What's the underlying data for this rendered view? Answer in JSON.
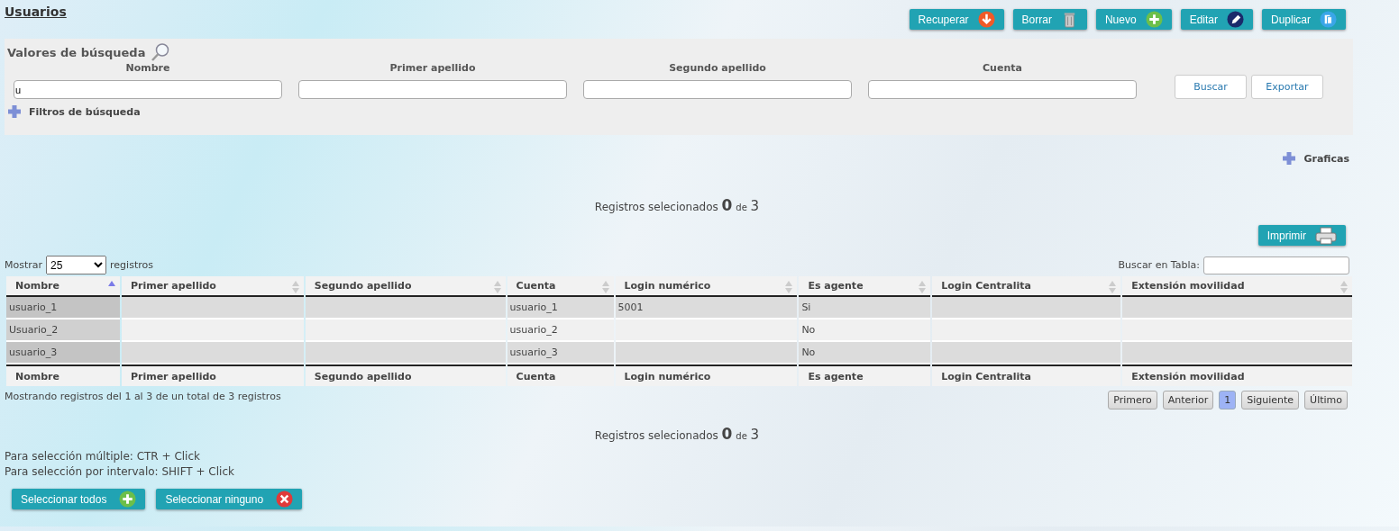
{
  "title": "Usuarios",
  "actions": [
    "Recuperar",
    "Borrar",
    "Nuevo",
    "Editar",
    "Duplicar"
  ],
  "search": {
    "title": "Valores de búsqueda",
    "fields": [
      {
        "label": "Nombre",
        "value": "u"
      },
      {
        "label": "Primer apellido"
      },
      {
        "label": "Segundo apellido"
      },
      {
        "label": "Cuenta"
      }
    ],
    "buttons": [
      "Buscar",
      "Exportar"
    ],
    "filters_label": "Filtros de búsqueda"
  },
  "charts_label": "Graficas",
  "selected_top": {
    "prefix": "Registros selecionados",
    "count": "0",
    "middle": "de",
    "total": "3"
  },
  "print_button": "Imprimir",
  "length": {
    "before": "Mostrar",
    "value": "25",
    "after": "registros"
  },
  "table_search_label": "Buscar en Tabla:",
  "table": {
    "columns": [
      {
        "label": "Nombre",
        "sorted": true
      },
      {
        "label": "Primer apellido",
        "sorted": false
      },
      {
        "label": "Segundo apellido",
        "sorted": false
      },
      {
        "label": "Cuenta",
        "sorted": false
      },
      {
        "label": "Login numérico",
        "sorted": false
      },
      {
        "label": "Es agente",
        "sorted": false
      },
      {
        "label": "Login Centralita",
        "sorted": false
      },
      {
        "label": "Extensión movilidad",
        "sorted": false
      }
    ],
    "rows": [
      [
        "usuario_1",
        "",
        "",
        "usuario_1",
        "5001",
        "Si",
        "",
        ""
      ],
      [
        "Usuario_2",
        "",
        "",
        "usuario_2",
        "",
        "No",
        "",
        ""
      ],
      [
        "usuario_3",
        "",
        "",
        "usuario_3",
        "",
        "No",
        "",
        ""
      ]
    ],
    "footer": [
      "Nombre",
      "Primer apellido",
      "Segundo apellido",
      "Cuenta",
      "Login numérico",
      "Es agente",
      "Login Centralita",
      "Extensión movilidad"
    ]
  },
  "info": "Mostrando registros del 1 al 3 de un total de 3 registros",
  "pagination": [
    {
      "label": "Primero",
      "selected": false
    },
    {
      "label": "Anterior",
      "selected": false
    },
    {
      "label": "1",
      "selected": true
    },
    {
      "label": "Siguiente",
      "selected": false
    },
    {
      "label": "Último",
      "selected": false
    }
  ],
  "selected_bottom": {
    "prefix": "Registros selecionados",
    "count": "0",
    "middle": "de",
    "total": "3"
  },
  "hints": [
    "Para selección múltiple: CTR + Click",
    "Para selección por intervalo: SHIFT + Click"
  ],
  "bottom_buttons": [
    "Seleccionar todos",
    "Seleccionar ninguno"
  ]
}
